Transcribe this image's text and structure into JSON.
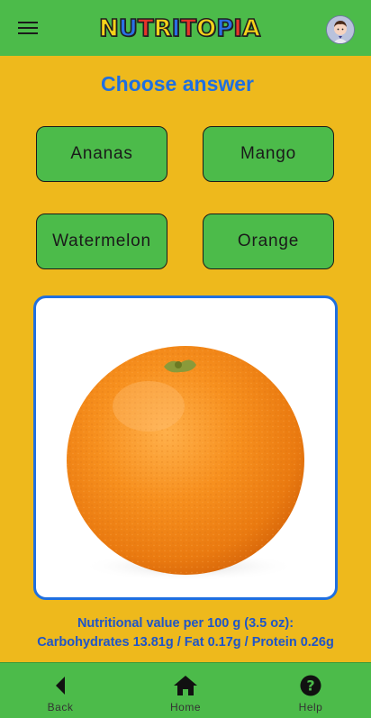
{
  "header": {
    "logo_letters": [
      "N",
      "U",
      "T",
      "R",
      "I",
      "T",
      "O",
      "P",
      "I",
      "A"
    ],
    "logo_colors": [
      "#f5d21a",
      "#2a6fe6",
      "#e8342a",
      "#f5d21a",
      "#2a6fe6",
      "#e8342a",
      "#f5d21a",
      "#2a6fe6",
      "#e8342a",
      "#f5d21a"
    ],
    "menu_icon": "hamburger-menu-icon",
    "avatar_icon": "user-avatar-icon"
  },
  "quiz": {
    "title": "Choose answer",
    "answers": [
      "Ananas",
      "Mango",
      "Watermelon",
      "Orange"
    ],
    "image": "orange-fruit"
  },
  "nutrition": {
    "line1": "Nutritional value per 100 g (3.5 oz):",
    "line2": "Carbohydrates 13.81g / Fat 0.17g / Protein 0.26g"
  },
  "bottom_nav": {
    "items": [
      {
        "label": "Back",
        "icon": "back-arrow-icon"
      },
      {
        "label": "Home",
        "icon": "home-icon"
      },
      {
        "label": "Help",
        "icon": "help-icon"
      }
    ]
  },
  "colors": {
    "background": "#eeb91c",
    "bar_green": "#4cbb4a",
    "accent_blue": "#1f6fe0"
  }
}
